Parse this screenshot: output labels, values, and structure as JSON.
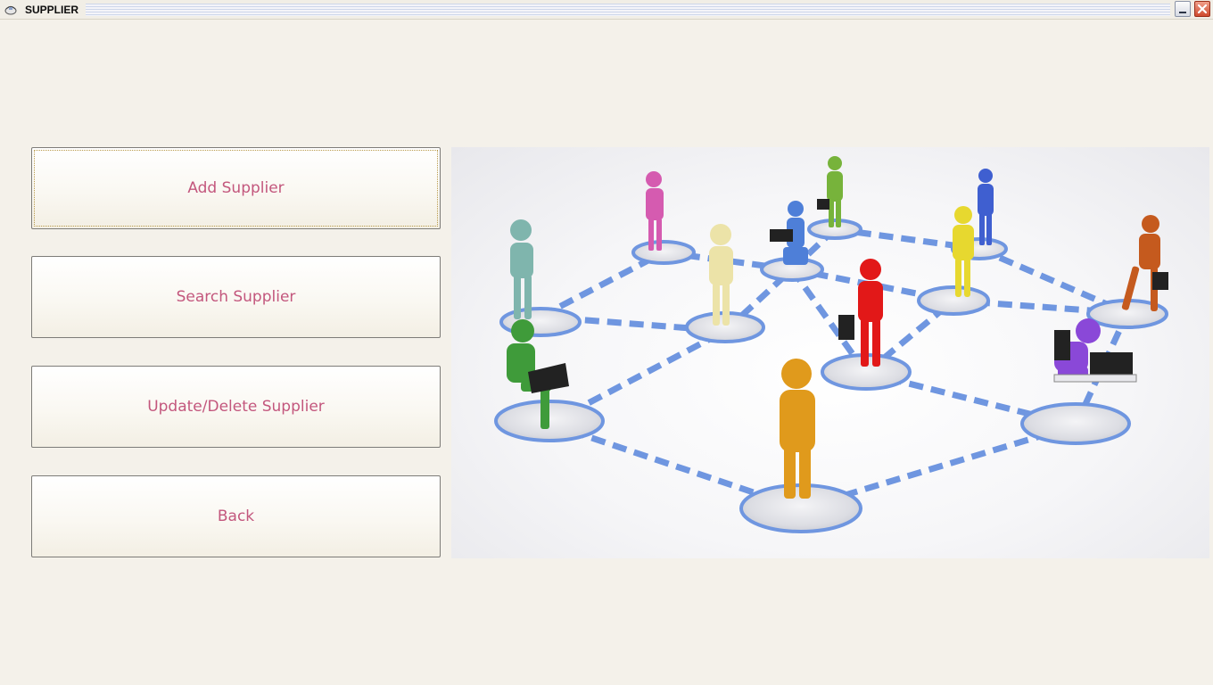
{
  "window": {
    "title": "SUPPLIER",
    "app_icon": "app-icon",
    "minimize_icon": "minimize-icon",
    "close_icon": "close-icon"
  },
  "menu": {
    "add_label": "Add Supplier",
    "search_label": "Search Supplier",
    "update_delete_label": "Update/Delete Supplier",
    "back_label": "Back"
  },
  "illustration": {
    "subject": "people-network-illustration"
  },
  "colors": {
    "button_text": "#c3577d",
    "background": "#f4f1ea",
    "network_line": "#6f96e0"
  }
}
